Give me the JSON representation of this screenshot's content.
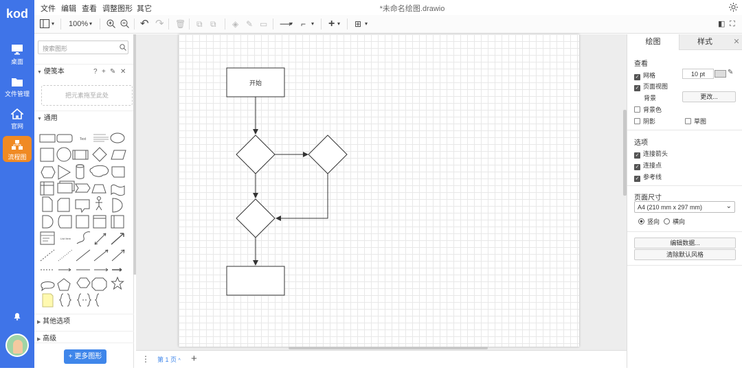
{
  "app": {
    "logo": "kod",
    "doc_title": "*未命名绘图.drawio"
  },
  "rail": {
    "items": [
      {
        "label": "桌面",
        "icon": "desktop-icon"
      },
      {
        "label": "文件管理",
        "icon": "folder-icon"
      },
      {
        "label": "官网",
        "icon": "home-icon"
      },
      {
        "label": "流程图",
        "icon": "flowchart-icon",
        "active": true
      }
    ]
  },
  "menu": [
    "文件",
    "编辑",
    "查看",
    "调整图形",
    "其它"
  ],
  "toolbar": {
    "zoom": "100%"
  },
  "shapes_panel": {
    "search_placeholder": "搜索图形",
    "scratchpad_title": "便笺本",
    "scratchpad_hint": "把元素拖至此处",
    "general_title": "通用",
    "other_title": "其他选项",
    "advanced_title": "高级",
    "more_button": "更多图形"
  },
  "diagram": {
    "start_label": "开始"
  },
  "pagebar": {
    "page_label": "第 1 页"
  },
  "format_panel": {
    "tabs": [
      "绘图",
      "样式"
    ],
    "view_title": "查看",
    "grid_label": "网格",
    "grid_size": "10 pt",
    "page_view_label": "页面视图",
    "background_label": "背景",
    "change_button": "更改...",
    "bg_color_label": "背景色",
    "shadow_label": "阴影",
    "sketch_label": "草图",
    "options_title": "选项",
    "connection_arrows": "连接箭头",
    "connection_points": "连接点",
    "guides": "参考线",
    "page_size_title": "页面尺寸",
    "page_size_value": "A4 (210 mm x 297 mm)",
    "portrait": "竖向",
    "landscape": "横向",
    "edit_data_button": "编辑数据...",
    "clear_style_button": "清除默认风格"
  },
  "colors": {
    "rail": "#3f74e8",
    "active": "#f08a24",
    "accent": "#3f86ea"
  }
}
